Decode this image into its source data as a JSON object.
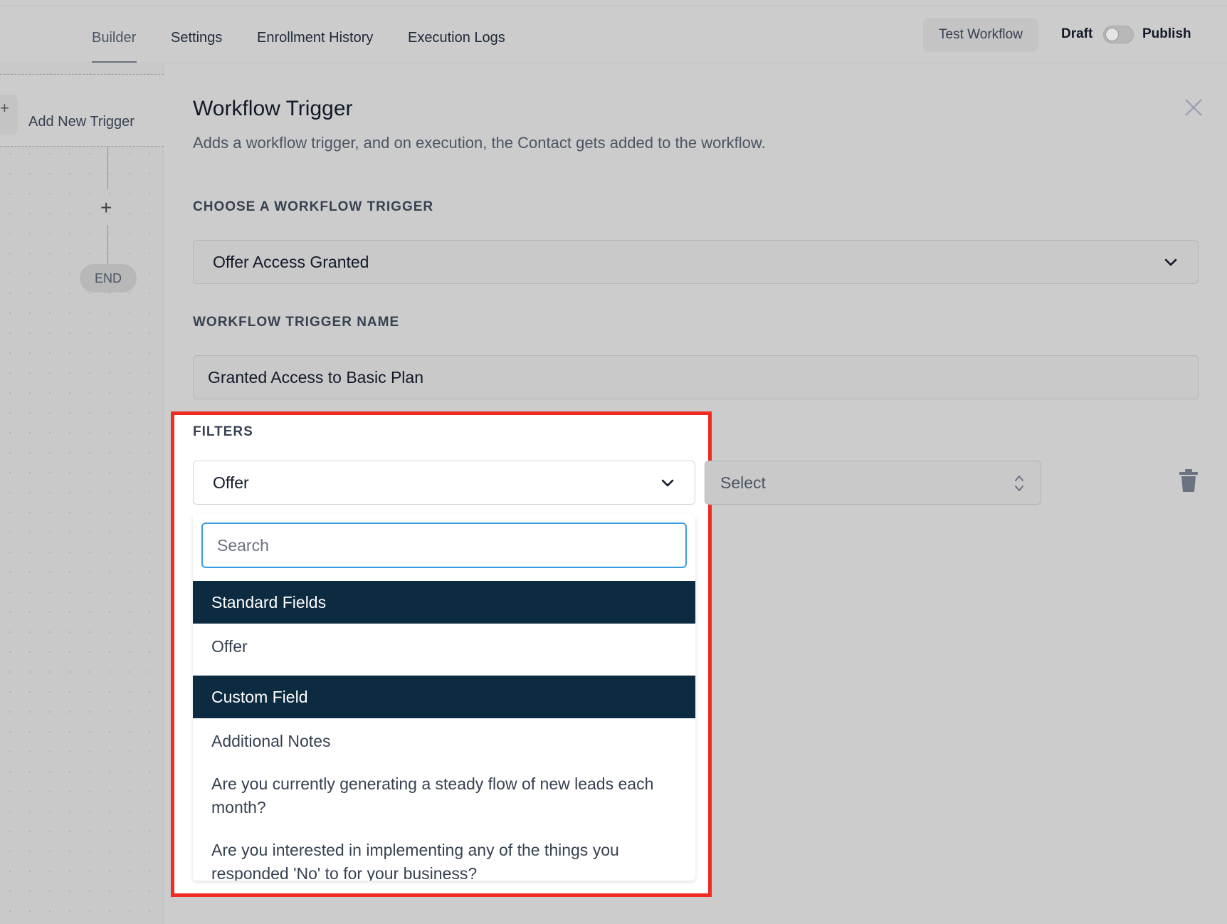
{
  "topbar": {
    "tabs": [
      {
        "label": "Builder",
        "active": true
      },
      {
        "label": "Settings",
        "active": false
      },
      {
        "label": "Enrollment History",
        "active": false
      },
      {
        "label": "Execution Logs",
        "active": false
      }
    ],
    "test_button": "Test Workflow",
    "draft_label": "Draft",
    "publish_label": "Publish",
    "publish_toggle_on": false
  },
  "canvas": {
    "add_trigger_label": "Add New Trigger",
    "end_label": "END"
  },
  "panel": {
    "title": "Workflow Trigger",
    "subtitle": "Adds a workflow trigger, and on execution, the Contact gets added to the workflow.",
    "choose_label": "CHOOSE A WORKFLOW TRIGGER",
    "trigger_value": "Offer Access Granted",
    "name_label": "WORKFLOW TRIGGER NAME",
    "name_value": "Granted Access to Basic Plan",
    "filters_label": "FILTERS",
    "filter_field_value": "Offer",
    "filter_operator_placeholder": "Select",
    "dropdown": {
      "search_placeholder": "Search",
      "groups": [
        {
          "header": "Standard Fields",
          "options": [
            "Offer"
          ]
        },
        {
          "header": "Custom Field",
          "options": [
            "Additional Notes",
            "Are you currently generating a steady flow of new leads each month?",
            "Are you interested in implementing any of the things you responded 'No' to for your business?"
          ]
        }
      ]
    }
  },
  "colors": {
    "group_header_bg": "#0c2a40",
    "highlight_border": "#ef2b24",
    "search_focus": "#3b9be0"
  }
}
